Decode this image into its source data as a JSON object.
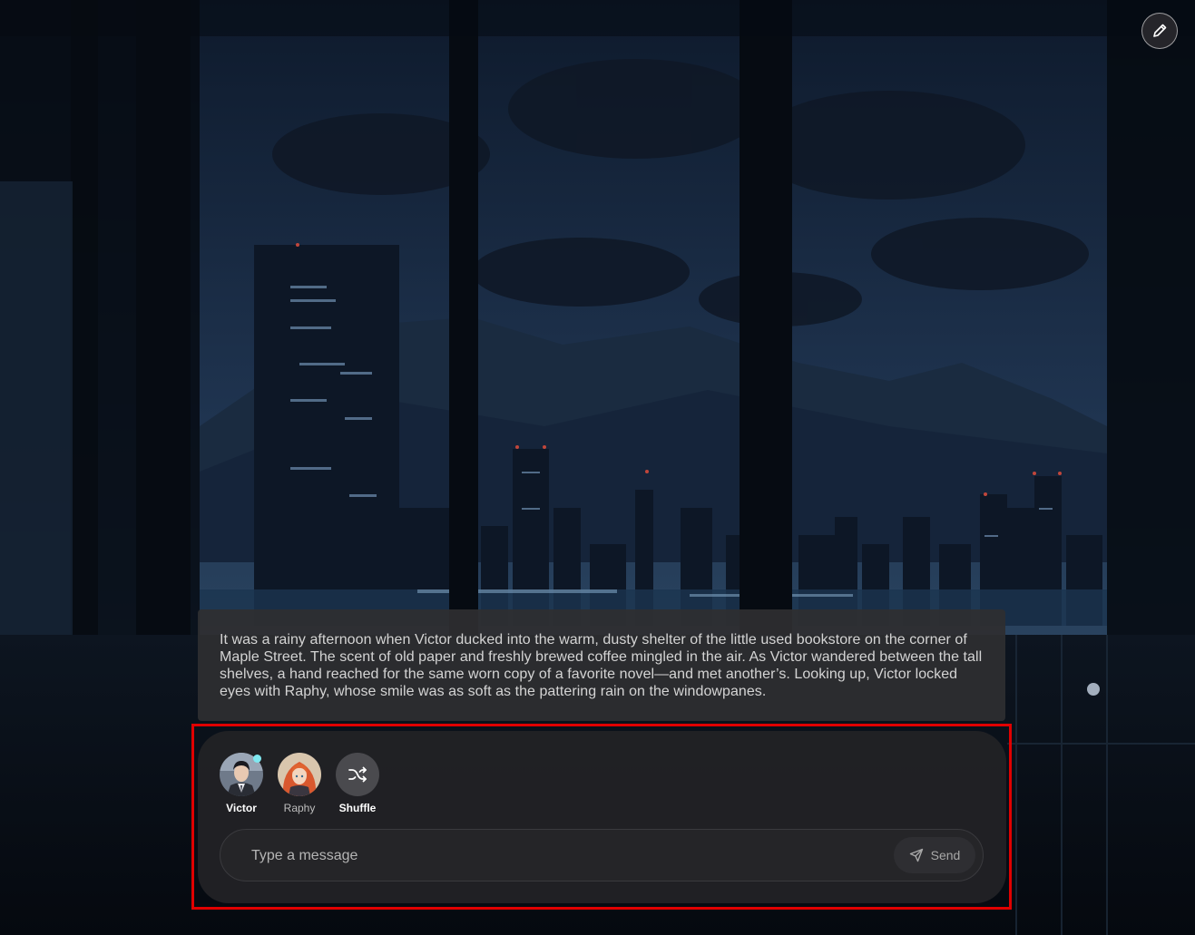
{
  "toolbar": {
    "edit_icon": "pencil-icon"
  },
  "narration": {
    "text": "It was a rainy afternoon when Victor ducked into the warm, dusty shelter of the little used bookstore on the corner of Maple Street. The scent of old paper and freshly brewed coffee mingled in the air. As Victor wandered between the tall shelves, a hand reached for the same worn copy of a favorite novel—and met another’s. Looking up, Victor locked eyes with Raphy, whose smile was as soft as the pattering rain on the windowpanes."
  },
  "participants": [
    {
      "name": "Victor",
      "active": true,
      "online": true
    },
    {
      "name": "Raphy",
      "active": false,
      "online": false
    }
  ],
  "shuffle": {
    "label": "Shuffle",
    "icon": "shuffle-icon"
  },
  "composer": {
    "placeholder": "Type a message",
    "send_label": "Send",
    "send_icon": "paper-plane-icon"
  },
  "colors": {
    "highlight_border": "#e00000",
    "online_dot": "#7fe8f0"
  }
}
